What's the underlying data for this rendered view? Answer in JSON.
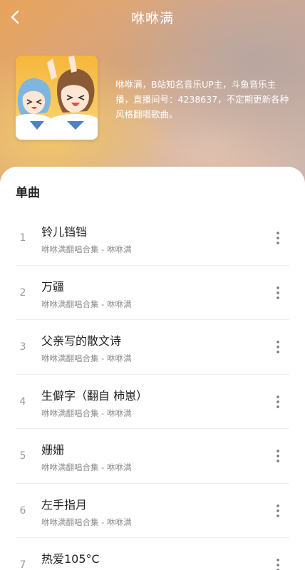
{
  "header": {
    "title": "咻咻满",
    "back_icon": "chevron-left-icon"
  },
  "artist": {
    "bio": "咻咻满，B站知名音乐UP主，斗鱼音乐主播，直播间号：4238637，不定期更新各种风格翻唱歌曲。"
  },
  "section": {
    "title": "单曲"
  },
  "songs": [
    {
      "index": "1",
      "title": "铃儿铛铛",
      "subtitle": "咻咻满翻唱合集 - 咻咻满"
    },
    {
      "index": "2",
      "title": "万疆",
      "subtitle": "咻咻满翻唱合集 - 咻咻满"
    },
    {
      "index": "3",
      "title": "父亲写的散文诗",
      "subtitle": "咻咻满翻唱合集 - 咻咻满"
    },
    {
      "index": "4",
      "title": "生僻字（翻自 柿崽）",
      "subtitle": "咻咻满翻唱合集 - 咻咻满"
    },
    {
      "index": "5",
      "title": "姗姗",
      "subtitle": "咻咻满翻唱合集 - 咻咻满"
    },
    {
      "index": "6",
      "title": "左手指月",
      "subtitle": "咻咻满翻唱合集 - 咻咻满"
    },
    {
      "index": "7",
      "title": "热爱105°C",
      "subtitle": ""
    }
  ],
  "icons": {
    "more": "more-vertical-icon"
  },
  "colors": {
    "accent_warm": "#e8a35a",
    "title_text": "#222222",
    "sub_text": "#8f8f8f"
  }
}
